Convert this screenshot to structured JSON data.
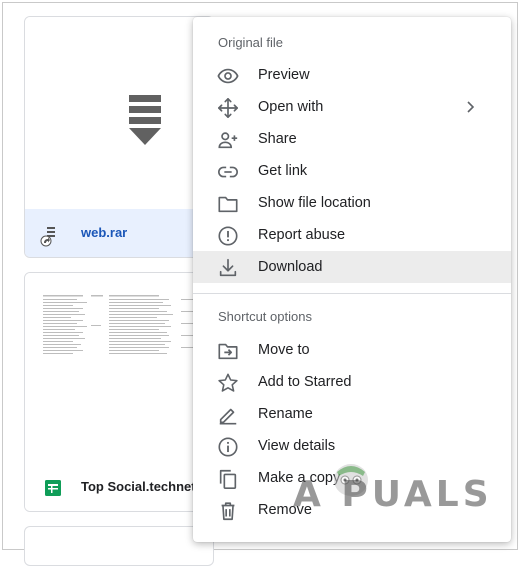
{
  "files": [
    {
      "name": "web.rar",
      "selected": true
    },
    {
      "name": "Top Social.technet",
      "selected": false
    }
  ],
  "menu": {
    "section_original": "Original file",
    "original_items": [
      {
        "label": "Preview",
        "icon": "eye-icon"
      },
      {
        "label": "Open with",
        "icon": "move-arrows-icon",
        "submenu": true
      },
      {
        "label": "Share",
        "icon": "person-add-icon"
      },
      {
        "label": "Get link",
        "icon": "link-icon"
      },
      {
        "label": "Show file location",
        "icon": "folder-icon"
      },
      {
        "label": "Report abuse",
        "icon": "alert-circle-icon"
      },
      {
        "label": "Download",
        "icon": "download-icon",
        "highlighted": true
      }
    ],
    "section_shortcut": "Shortcut options",
    "shortcut_items": [
      {
        "label": "Move to",
        "icon": "move-to-folder-icon"
      },
      {
        "label": "Add to Starred",
        "icon": "star-icon"
      },
      {
        "label": "Rename",
        "icon": "pencil-icon"
      },
      {
        "label": "View details",
        "icon": "info-icon"
      },
      {
        "label": "Make a copy",
        "icon": "copy-icon"
      },
      {
        "label": "Remove",
        "icon": "trash-icon"
      }
    ]
  },
  "watermark": {
    "text": "A PUALS"
  },
  "colors": {
    "accent": "#1a56b8",
    "selected_bg": "#e8f0fe",
    "highlight_bg": "#ececec",
    "sheets_green": "#0f9d58"
  }
}
